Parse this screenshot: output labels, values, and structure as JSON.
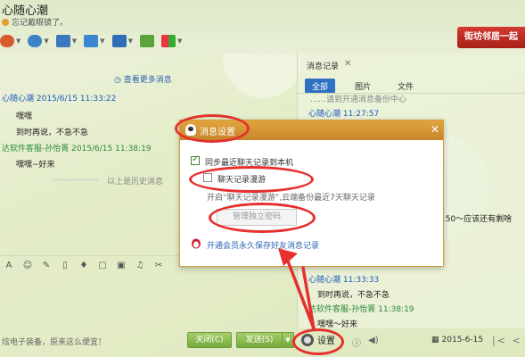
{
  "header": {
    "contact_name": "心随心潮",
    "status_text": "忘记戴眼镜了。"
  },
  "ad_banner": "街坊邻居一起",
  "chat": {
    "more_messages": "查看更多消息",
    "messages": [
      {
        "sender": "心随心潮 2015/6/15 11:33:22",
        "lines": [
          "嘿嘿",
          "到时再说，不急不急"
        ]
      },
      {
        "sender": "达软件客服-孙怡箐 2015/6/15 11:38:19",
        "lines": [
          "嘿嘿~好来"
        ]
      }
    ],
    "history_divider": "以上是历史消息"
  },
  "bottom": {
    "promo_text": "炫电子装备，原来这么便宜！",
    "close_button": "关闭(C)",
    "send_button": "发送(S)",
    "settings_label": "设置",
    "date": "2015-6-15"
  },
  "history_panel": {
    "title": "消息记录",
    "tabs": [
      "全部",
      "图片",
      "文件"
    ],
    "partial_line": "……请到开通消息备份中心",
    "sender1": "心随心潮 11:27:57",
    "partial_line2": "150～应该还有剩啥",
    "sender2": "心随心潮 11:33:33",
    "message2": "到时再说，不急不急",
    "sender3": "达软件客服-孙怡箐 11:38:19",
    "message3": "嘿嘿～好来"
  },
  "popup": {
    "title": "消息设置",
    "sync_option": "同步最近聊天记录到本机",
    "roaming_option": "聊天记录漫游",
    "roaming_hint": "开启“聊天记录漫游”,云端备份最近7天聊天记录",
    "password_button": "管理独立密码",
    "vip_link": "开通会员永久保存好友消息记录"
  },
  "colors": {
    "accent_red": "#e4312f",
    "popup_header": "#d49436",
    "link_blue": "#2d64b3",
    "send_green": "#76a83a"
  }
}
